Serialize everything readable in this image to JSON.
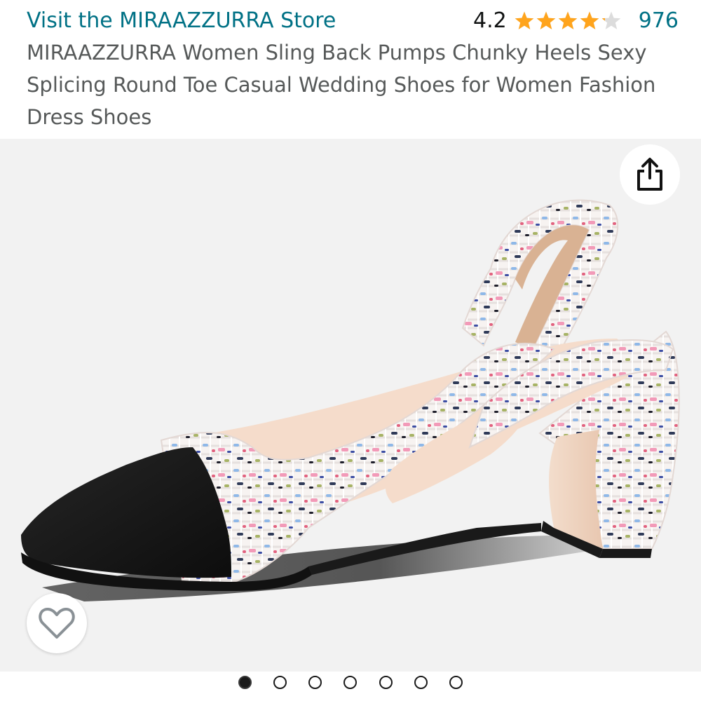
{
  "store": {
    "link_label": "Visit the MIRAAZZURRA Store"
  },
  "rating": {
    "value": "4.2",
    "stars": 4.2,
    "star_color": "#ffa41c",
    "count": "976"
  },
  "product": {
    "title": "MIRAAZZURRA Women Sling Back Pumps Chunky Heels Sexy Splicing Round Toe Casual Wedding Shoes for Women Fashion Dress Shoes"
  },
  "icons": {
    "share": "share-icon",
    "wishlist": "heart-outline-icon"
  },
  "carousel": {
    "total": 7,
    "active_index": 0
  },
  "colors": {
    "link": "#007185",
    "title_text": "#565959",
    "image_background": "#f2f2f2"
  }
}
